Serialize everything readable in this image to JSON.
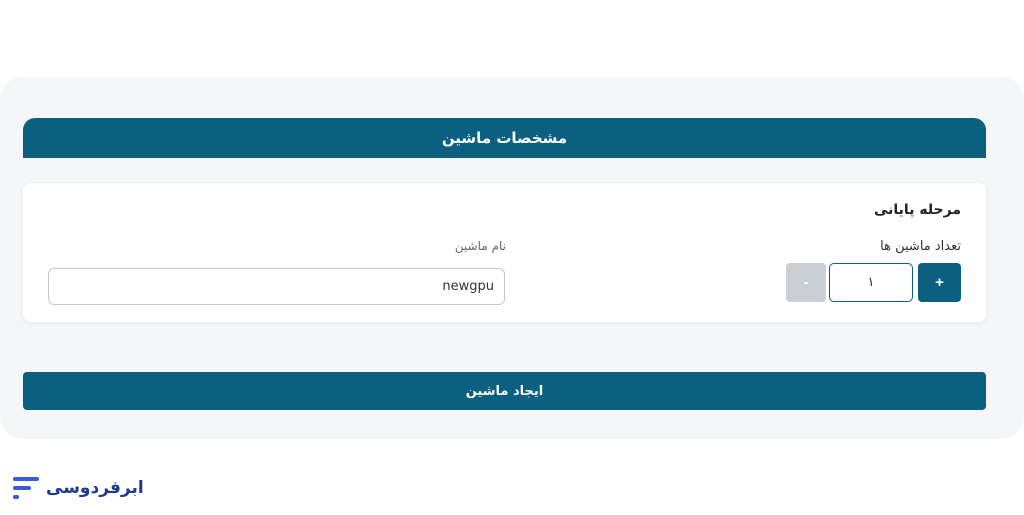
{
  "header": {
    "title": "مشخصات ماشین"
  },
  "card": {
    "section_title": "مرحله پایانی",
    "count_label": "تعداد ماشین ها",
    "name_label": "نام ماشین",
    "plus_label": "+",
    "minus_label": "-",
    "quantity_value": "۱",
    "name_value": "newgpu"
  },
  "footer": {
    "create_label": "ایجاد ماشین"
  },
  "brand": {
    "name": "ابرفردوسی"
  },
  "colors": {
    "primary": "#0b6080",
    "disabled": "#c9cfd3",
    "page_bg": "#f5f6f8",
    "logo": "#1f3a8a"
  }
}
